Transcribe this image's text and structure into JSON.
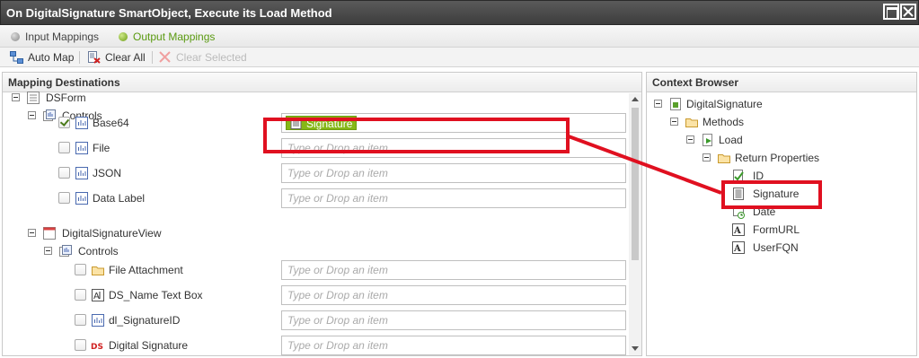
{
  "window": {
    "title": "On DigitalSignature SmartObject, Execute its Load Method"
  },
  "tabs": {
    "input": "Input Mappings",
    "output": "Output Mappings"
  },
  "toolbar": {
    "auto_map": "Auto Map",
    "clear_all": "Clear All",
    "clear_selected": "Clear Selected"
  },
  "left_panel": {
    "header": "Mapping Destinations",
    "form": "DSForm",
    "form_controls": "Controls",
    "view": "DigitalSignatureView",
    "view_controls": "Controls",
    "placeholder": "Type or Drop an item",
    "form_rows": [
      {
        "label": "Base64",
        "checked": true,
        "mapped": "Signature"
      },
      {
        "label": "File",
        "checked": false,
        "mapped": ""
      },
      {
        "label": "JSON",
        "checked": false,
        "mapped": ""
      },
      {
        "label": "Data Label",
        "checked": false,
        "mapped": ""
      }
    ],
    "view_rows": [
      {
        "label": "File Attachment",
        "icon": "folder-icon"
      },
      {
        "label": "DS_Name Text Box",
        "icon": "textbox-icon"
      },
      {
        "label": "dl_SignatureID",
        "icon": "label-icon"
      },
      {
        "label": "Digital Signature",
        "icon": "ds-icon",
        "icon_text": "DS"
      }
    ]
  },
  "right_panel": {
    "header": "Context Browser",
    "tree": {
      "root": "DigitalSignature",
      "methods": "Methods",
      "load": "Load",
      "return_properties": "Return Properties",
      "properties": [
        "ID",
        "Signature",
        "Date",
        "FormURL",
        "UserFQN"
      ]
    }
  },
  "colors": {
    "accent_green": "#86b817",
    "highlight_red": "#e01020",
    "titlebar": "#3d3d3d"
  }
}
